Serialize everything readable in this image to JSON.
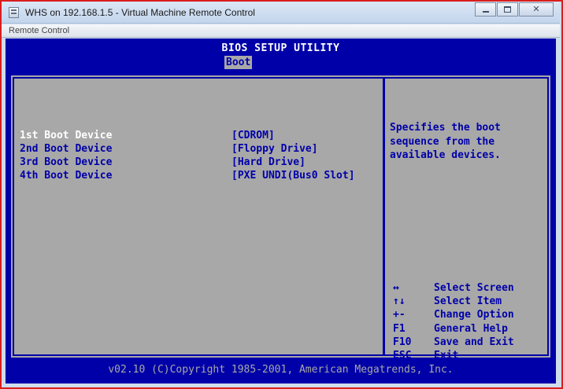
{
  "window": {
    "title": "WHS on 192.168.1.5 - Virtual Machine Remote Control",
    "minimize_glyph": "",
    "maximize_glyph": "",
    "close_glyph": "✕"
  },
  "menu": {
    "remote_control_label": "Remote Control"
  },
  "bios": {
    "title": "BIOS SETUP UTILITY",
    "active_tab": "Boot",
    "boot_devices": [
      {
        "label": "1st Boot Device",
        "value": "[CDROM]"
      },
      {
        "label": "2nd Boot Device",
        "value": "[Floppy Drive]"
      },
      {
        "label": "3rd Boot Device",
        "value": "[Hard Drive]"
      },
      {
        "label": "4th Boot Device",
        "value": "[PXE UNDI(Bus0 Slot]"
      }
    ],
    "help_lines": [
      "Specifies the boot",
      "sequence from the",
      "available devices."
    ],
    "keys": [
      {
        "key": "↔",
        "action": "Select Screen"
      },
      {
        "key": "↑↓",
        "action": "Select Item"
      },
      {
        "key": "+-",
        "action": "Change Option"
      },
      {
        "key": "F1",
        "action": "General Help"
      },
      {
        "key": "F10",
        "action": "Save and Exit"
      },
      {
        "key": "ESC",
        "action": "Exit"
      }
    ],
    "footer": "v02.10 (C)Copyright 1985-2001, American Megatrends, Inc."
  },
  "colors": {
    "bios_blue": "#0000a8",
    "bios_gray": "#a8a8a8",
    "selected_text": "#ffffff",
    "frame_red": "#d81e1e"
  }
}
